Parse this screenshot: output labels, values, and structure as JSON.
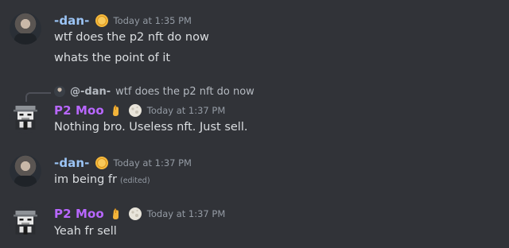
{
  "messages": [
    {
      "user": "-dan-",
      "timestamp": "Today at 1:35 PM",
      "lines": [
        "wtf does the p2 nft do now",
        "whats the point of it"
      ]
    },
    {
      "reply": {
        "mention": "@-dan-",
        "text": "wtf does the p2 nft do now"
      },
      "user": "P2 Moo",
      "timestamp": "Today at 1:37 PM",
      "lines": [
        "Nothing bro. Useless nft. Just sell."
      ]
    },
    {
      "user": "-dan-",
      "timestamp": "Today at 1:37 PM",
      "lines": [
        "im being fr"
      ],
      "edited": "(edited)"
    },
    {
      "user": "P2 Moo",
      "timestamp": "Today at 1:37 PM",
      "lines": [
        "Yeah fr sell"
      ]
    }
  ],
  "colors": {
    "background": "#313338",
    "dan_name": "#9bc4f5",
    "moo_name": "#b867ff",
    "timestamp": "#949ba4",
    "text": "#dbdee1"
  },
  "icons": {
    "dan_badge": "gold-coin-icon",
    "moo_badge_1": "crossed-fingers-icon",
    "moo_badge_2": "moon-icon"
  }
}
